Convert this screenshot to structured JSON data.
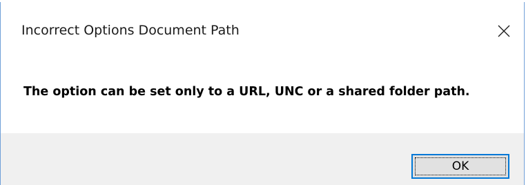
{
  "dialog": {
    "title": "Incorrect Options Document Path",
    "close_icon": "close-icon",
    "message": "The option can be set only to a URL, UNC or a shared folder path.",
    "ok_label": "OK"
  },
  "colors": {
    "window_border": "#6f9fd8",
    "button_bar_bg": "#f0f0f0",
    "button_bg": "#e1e1e1",
    "button_focus": "#0078d7"
  }
}
